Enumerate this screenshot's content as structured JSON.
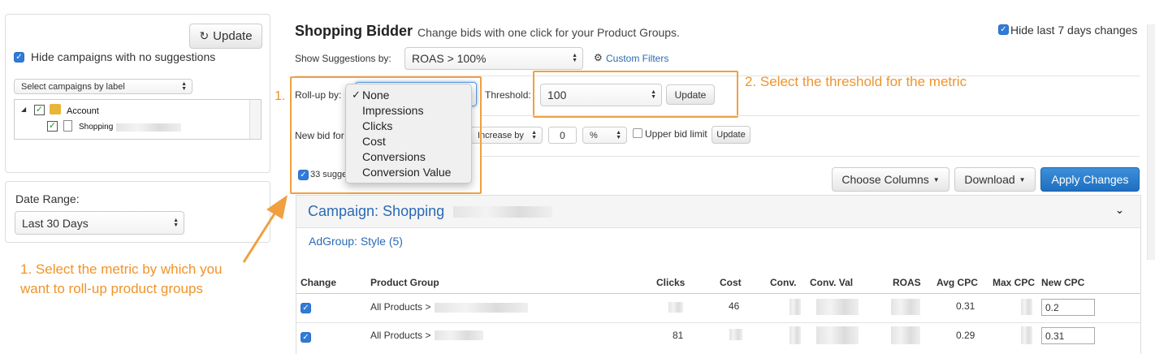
{
  "sidebar": {
    "update_label": "Update",
    "hide_no_suggestions": "Hide campaigns with no suggestions",
    "label_select": "Select campaigns by label",
    "tree": {
      "account": "Account",
      "campaign": "Shopping"
    },
    "date_range_label": "Date Range:",
    "date_range_value": "Last 30 Days"
  },
  "header": {
    "title": "Shopping Bidder",
    "subtitle": "Change bids with one click for your Product Groups.",
    "hide_last_7": "Hide last 7 days changes"
  },
  "controls": {
    "show_suggestions_label": "Show Suggestions by:",
    "show_suggestions_value": "ROAS > 100%",
    "custom_filters": "Custom Filters",
    "rollup_label": "Roll-up by:",
    "threshold_label": "Threshold:",
    "threshold_value": "100",
    "threshold_update": "Update",
    "new_bid_label": "New bid for",
    "increase_value": "Increase by",
    "increase_amount": "0",
    "unit_value": "%",
    "upper_bid_limit": "Upper bid limit",
    "new_bid_update": "Update",
    "suggestions_count": "33 sugge",
    "choose_columns": "Choose Columns",
    "download": "Download",
    "apply_changes": "Apply Changes"
  },
  "rollup_menu": {
    "checkmark": "✓",
    "items": [
      "None",
      "Impressions",
      "Clicks",
      "Cost",
      "Conversions",
      "Conversion Value"
    ]
  },
  "annotations": {
    "step1_number": "1.",
    "step1_text_line1": "1. Select the metric by which you",
    "step1_text_line2": "want to roll-up product groups",
    "step2_text": "2. Select the threshold for the metric",
    "color": "#f0932b"
  },
  "campaign": {
    "title": "Campaign: Shopping",
    "adgroup": "AdGroup: Style (5)",
    "chevron": "⌄"
  },
  "table": {
    "headers": [
      "Change",
      "Product Group",
      "Clicks",
      "Cost",
      "Conv.",
      "Conv. Val",
      "ROAS",
      "Avg CPC",
      "Max CPC",
      "New CPC"
    ],
    "rows": [
      {
        "product_group": "All Products >",
        "clicks": "",
        "cost": "46",
        "avg_cpc": "0.31",
        "new_cpc": "0.2"
      },
      {
        "product_group": "All Products >",
        "clicks": "81",
        "cost": "",
        "avg_cpc": "0.29",
        "new_cpc": "0.31"
      }
    ]
  },
  "colors": {
    "accent": "#2f7bd9",
    "primary_button": "#1f6fbf",
    "link": "#2a6ab5",
    "annotation": "#f0932b"
  }
}
